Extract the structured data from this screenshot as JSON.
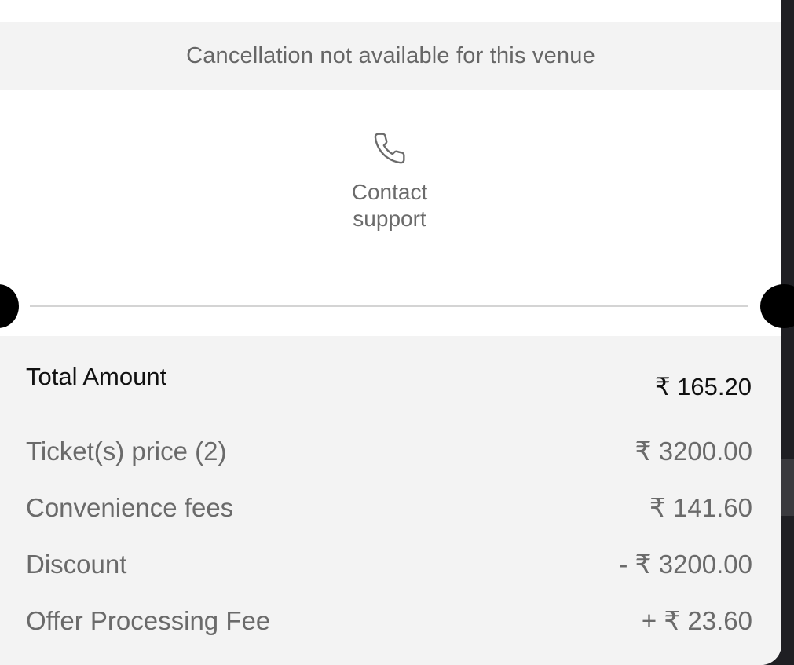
{
  "cancellation": {
    "message": "Cancellation not available for this venue"
  },
  "support": {
    "icon": "phone-icon",
    "label_line1": "Contact",
    "label_line2": "support"
  },
  "summary": {
    "total_label": "Total Amount",
    "total_value": "₹ 165.20",
    "lines": [
      {
        "label": "Ticket(s) price (2)",
        "value": "₹ 3200.00"
      },
      {
        "label": "Convenience fees",
        "value": "₹ 141.60"
      },
      {
        "label": "Discount",
        "value": "- ₹ 3200.00"
      },
      {
        "label": "Offer Processing Fee",
        "value": "+ ₹ 23.60"
      }
    ]
  },
  "colors": {
    "banner_bg": "#f3f3f3",
    "sheet_bg": "#ffffff",
    "muted_text": "#6a6a6a",
    "primary_text": "#111111"
  }
}
